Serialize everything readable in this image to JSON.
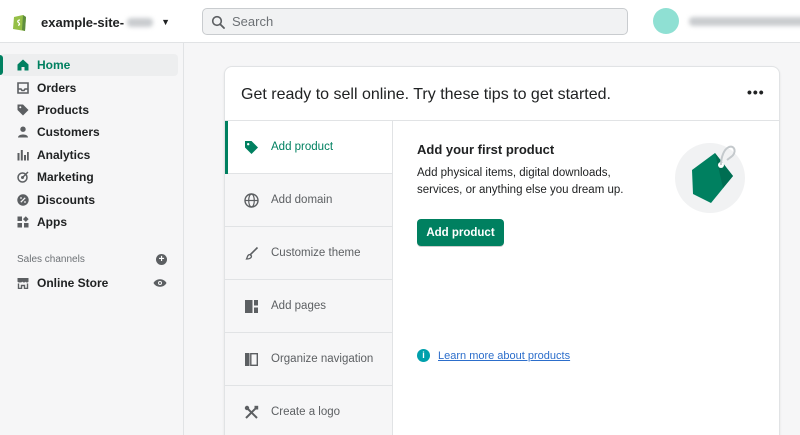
{
  "topbar": {
    "store_name": "example-site-",
    "search_placeholder": "Search"
  },
  "sidebar": {
    "items": [
      {
        "label": "Home",
        "icon": "home-icon"
      },
      {
        "label": "Orders",
        "icon": "inbox-icon"
      },
      {
        "label": "Products",
        "icon": "tag-icon"
      },
      {
        "label": "Customers",
        "icon": "person-icon"
      },
      {
        "label": "Analytics",
        "icon": "bar-chart-icon"
      },
      {
        "label": "Marketing",
        "icon": "target-icon"
      },
      {
        "label": "Discounts",
        "icon": "discount-icon"
      },
      {
        "label": "Apps",
        "icon": "apps-icon"
      }
    ],
    "active_item": "Home",
    "sales_channels_label": "Sales channels",
    "online_store_label": "Online Store"
  },
  "card": {
    "title": "Get ready to sell online. Try these tips to get started.",
    "more": "•••",
    "tips": [
      {
        "label": "Add product",
        "icon": "tag-icon"
      },
      {
        "label": "Add domain",
        "icon": "globe-icon"
      },
      {
        "label": "Customize theme",
        "icon": "brush-icon"
      },
      {
        "label": "Add pages",
        "icon": "pages-icon"
      },
      {
        "label": "Organize navigation",
        "icon": "navigation-icon"
      },
      {
        "label": "Create a logo",
        "icon": "tools-icon"
      }
    ],
    "active_tip": "Add product",
    "detail": {
      "title": "Add your first product",
      "description": "Add physical items, digital downloads, services, or anything else you dream up.",
      "button": "Add product",
      "learn_more": "Learn more about products"
    }
  },
  "colors": {
    "accent": "#008060",
    "avatar": "#8fe0d3",
    "link": "#2c6ecb",
    "info": "#00a0ac"
  }
}
